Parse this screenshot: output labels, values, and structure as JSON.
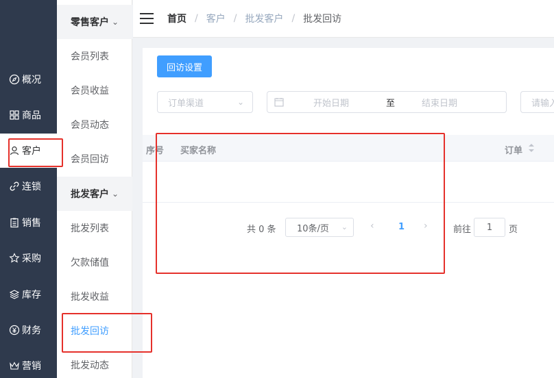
{
  "nav": {
    "items": [
      {
        "label": "概况",
        "icon": "compass-icon"
      },
      {
        "label": "商品",
        "icon": "grid-icon"
      },
      {
        "label": "客户",
        "icon": "user-icon"
      },
      {
        "label": "连锁",
        "icon": "link-icon"
      },
      {
        "label": "销售",
        "icon": "clipboard-icon"
      },
      {
        "label": "采购",
        "icon": "star-icon"
      },
      {
        "label": "库存",
        "icon": "layers-icon"
      },
      {
        "label": "财务",
        "icon": "yen-icon"
      },
      {
        "label": "营销",
        "icon": "crown-icon"
      }
    ],
    "active": "客户"
  },
  "submenu": {
    "retail_group": "零售客户",
    "retail_items": [
      "会员列表",
      "会员收益",
      "会员动态",
      "会员回访"
    ],
    "wholesale_group": "批发客户",
    "wholesale_items": [
      "批发列表",
      "欠款储值",
      "批发收益",
      "批发回访",
      "批发动态"
    ],
    "active": "批发回访"
  },
  "header": {
    "breadcrumb": [
      "首页",
      "客户",
      "批发客户",
      "批发回访"
    ],
    "separator": "/"
  },
  "toolbar": {
    "settings_button": "回访设置"
  },
  "filters": {
    "channel_placeholder": "订单渠道",
    "start_date_placeholder": "开始日期",
    "range_separator": "至",
    "end_date_placeholder": "结束日期",
    "keyword_placeholder": "请输入"
  },
  "table": {
    "columns": [
      "序号",
      "买家名称",
      "订单"
    ]
  },
  "pagination": {
    "total": "共 0 条",
    "page_size": "10条/页",
    "current_page": "1",
    "goto_label": "前往",
    "goto_value": "1",
    "page_suffix": "页"
  },
  "colors": {
    "nav_bg": "#2f3a4d",
    "primary": "#409eff",
    "annotation_red": "#e5302a"
  }
}
